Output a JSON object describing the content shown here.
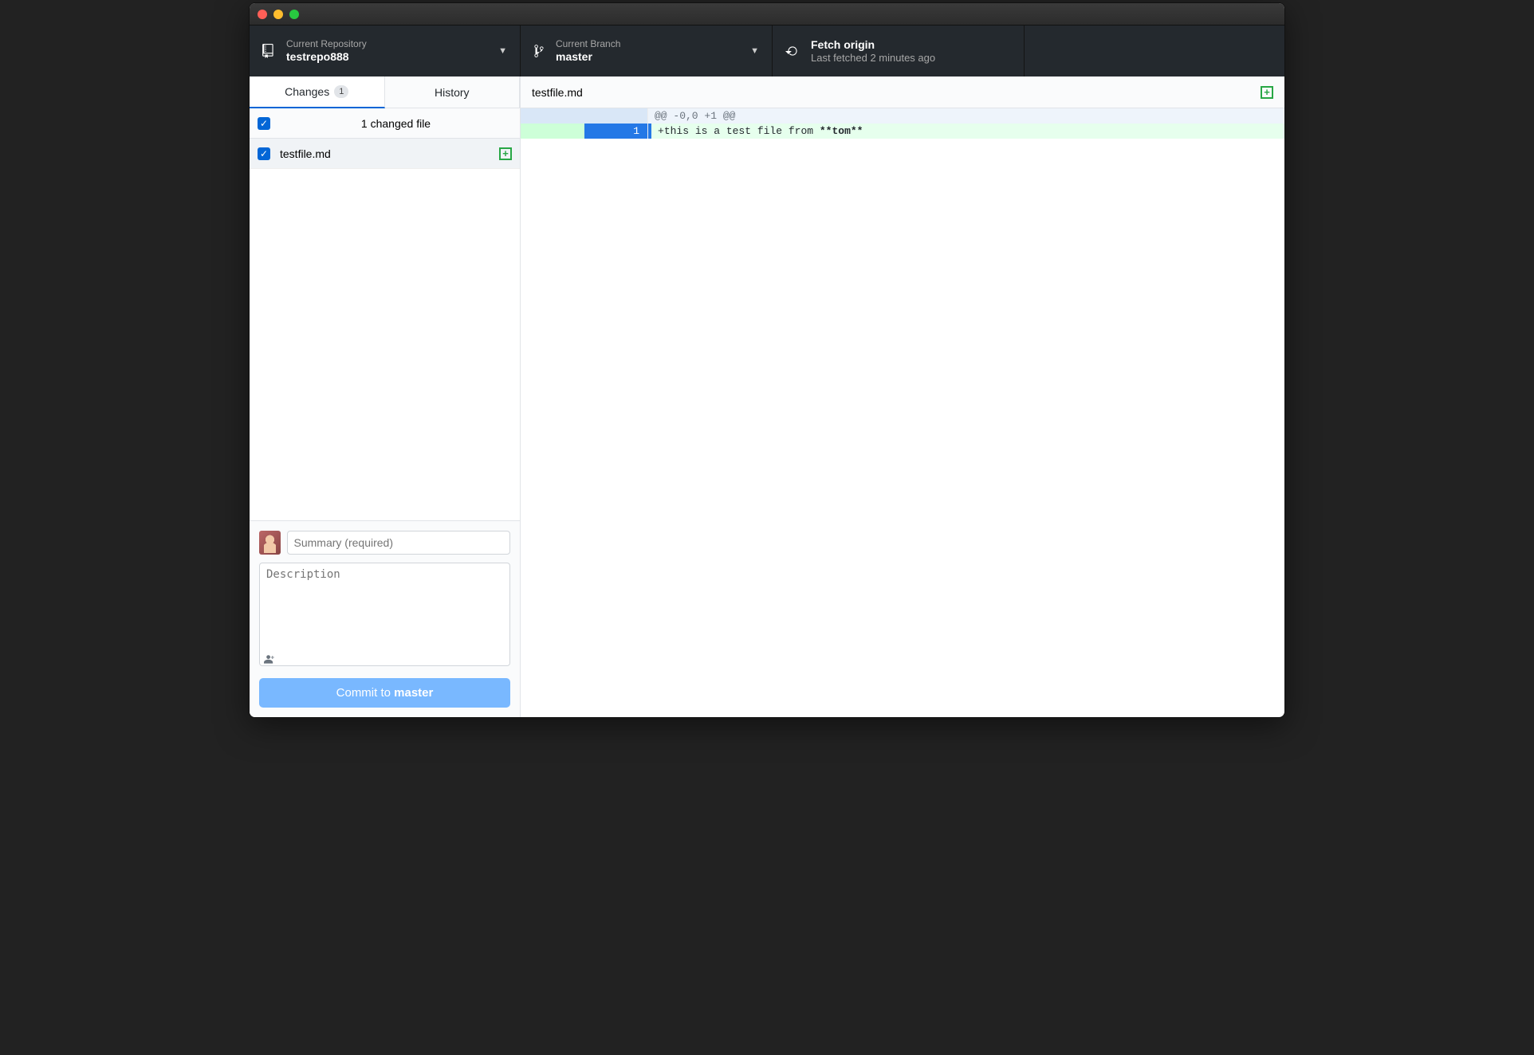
{
  "toolbar": {
    "repo": {
      "label": "Current Repository",
      "value": "testrepo888"
    },
    "branch": {
      "label": "Current Branch",
      "value": "master"
    },
    "fetch": {
      "title": "Fetch origin",
      "sub": "Last fetched 2 minutes ago"
    }
  },
  "tabs": {
    "changes": {
      "label": "Changes",
      "count": "1"
    },
    "history": {
      "label": "History"
    }
  },
  "changes": {
    "header": "1 changed file",
    "files": [
      {
        "name": "testfile.md",
        "status": "added",
        "checked": true
      }
    ]
  },
  "commit": {
    "summary_placeholder": "Summary (required)",
    "desc_placeholder": "Description",
    "button_prefix": "Commit to ",
    "button_branch": "master"
  },
  "diff": {
    "filename": "testfile.md",
    "status": "added",
    "hunk": "@@ -0,0 +1 @@",
    "lines": [
      {
        "old": "",
        "new": "1",
        "prefix": "+",
        "text": "this is a test file from ",
        "bold": "**tom**",
        "type": "added"
      }
    ]
  }
}
